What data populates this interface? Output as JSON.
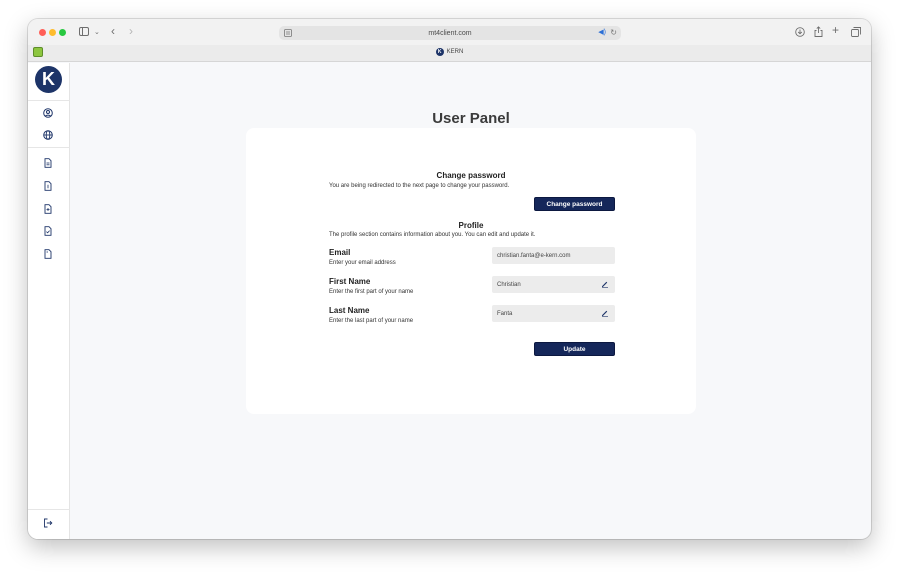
{
  "browser": {
    "url": "mt4client.com",
    "tab_title": "KERN",
    "favicon_letter": "K"
  },
  "sidebar": {
    "logo_letter": "K",
    "items": [
      {
        "icon": "user-circle-icon"
      },
      {
        "icon": "globe-icon"
      },
      {
        "icon": "document-icon"
      },
      {
        "icon": "document-icon"
      },
      {
        "icon": "document-icon"
      },
      {
        "icon": "document-check-icon"
      },
      {
        "icon": "document-icon"
      }
    ],
    "logout_icon": "logout-icon"
  },
  "page": {
    "title": "User Panel"
  },
  "change_password": {
    "title": "Change password",
    "description": "You are being redirected to the next page to change your password.",
    "button_label": "Change password"
  },
  "profile": {
    "title": "Profile",
    "description": "The profile section contains information about you. You can edit and update it.",
    "fields": {
      "email": {
        "label": "Email",
        "help": "Enter your email address",
        "value": "christian.fanta@e-kern.com"
      },
      "first_name": {
        "label": "First Name",
        "help": "Enter the first part of your name",
        "value": "Christian"
      },
      "last_name": {
        "label": "Last Name",
        "help": "Enter the last part of your name",
        "value": "Fanta"
      }
    },
    "update_label": "Update"
  },
  "colors": {
    "brand": "#15275a",
    "background": "#f7f8fa"
  }
}
